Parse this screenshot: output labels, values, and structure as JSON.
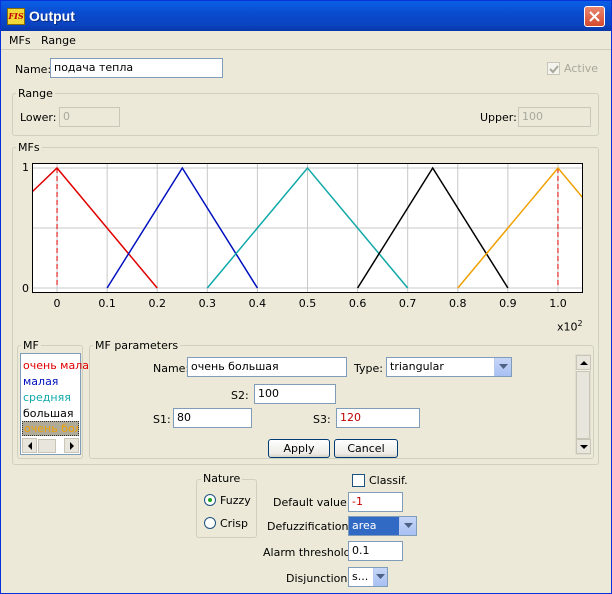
{
  "window": {
    "title": "Output",
    "icon": "fispro-app-icon"
  },
  "menu": [
    "MFs",
    "Range"
  ],
  "name_label": "Name:",
  "name_value": "подача тепла",
  "active_label": "Active",
  "active_checked": true,
  "range": {
    "legend": "Range",
    "lower_label": "Lower:",
    "lower_value": "0",
    "upper_label": "Upper:",
    "upper_value": "100"
  },
  "mfs_panel": {
    "legend": "MFs"
  },
  "chart_data": {
    "type": "line",
    "xlim": [
      -0.05,
      1.05
    ],
    "ylim": [
      0,
      1
    ],
    "x_ticks": [
      "0",
      "0.1",
      "0.2",
      "0.3",
      "0.4",
      "0.5",
      "0.6",
      "0.7",
      "0.8",
      "0.9",
      "1.0"
    ],
    "x_tick_values": [
      0,
      0.1,
      0.2,
      0.3,
      0.4,
      0.5,
      0.6,
      0.7,
      0.8,
      0.9,
      1.0
    ],
    "y_ticks": [
      "0",
      "1"
    ],
    "x_multiplier": "x10",
    "x_multiplier_exp": "2",
    "grid": true,
    "series": [
      {
        "color": "#e00000",
        "points": [
          [
            -0.05,
            0.8
          ],
          [
            0,
            1
          ],
          [
            0.2,
            0
          ]
        ]
      },
      {
        "color": "#0010c0",
        "points": [
          [
            0.1,
            0
          ],
          [
            0.25,
            1
          ],
          [
            0.4,
            0
          ]
        ]
      },
      {
        "color": "#10a8a8",
        "points": [
          [
            0.3,
            0
          ],
          [
            0.5,
            1
          ],
          [
            0.7,
            0
          ]
        ]
      },
      {
        "color": "#000000",
        "points": [
          [
            0.6,
            0
          ],
          [
            0.75,
            1
          ],
          [
            0.9,
            0
          ]
        ]
      },
      {
        "color": "#f0a000",
        "points": [
          [
            0.8,
            0
          ],
          [
            1.0,
            1
          ],
          [
            1.05,
            0.75
          ]
        ]
      }
    ],
    "dashed_x": [
      0,
      1.0
    ],
    "dashed_color": "#e00000"
  },
  "mf_list": {
    "legend": "MF",
    "items": [
      {
        "label": "очень мала",
        "color": "#e00000"
      },
      {
        "label": "малая",
        "color": "#0010c0"
      },
      {
        "label": "средняя",
        "color": "#10a8a8"
      },
      {
        "label": "большая",
        "color": "#000000"
      },
      {
        "label": "очень боль",
        "color": "#f0a000"
      }
    ]
  },
  "mf_params": {
    "legend": "MF parameters",
    "name_label": "Name:",
    "name_value": "очень большая",
    "type_label": "Type:",
    "type_value": "triangular",
    "s1_label": "S1:",
    "s1_value": "80",
    "s2_label": "S2:",
    "s2_value": "100",
    "s3_label": "S3:",
    "s3_value": "120",
    "apply_label": "Apply",
    "cancel_label": "Cancel"
  },
  "nature": {
    "legend": "Nature",
    "fuzzy_label": "Fuzzy",
    "crisp_label": "Crisp",
    "selected": "Fuzzy"
  },
  "classif_label": "Classif.",
  "default_value_label": "Default value:",
  "default_value": "-1",
  "defuzz_label": "Defuzzification:",
  "defuzz_value": "area",
  "alarm_label": "Alarm threshold:",
  "alarm_value": "0.1",
  "disjunction_label": "Disjunction:",
  "disjunction_value": "s..."
}
